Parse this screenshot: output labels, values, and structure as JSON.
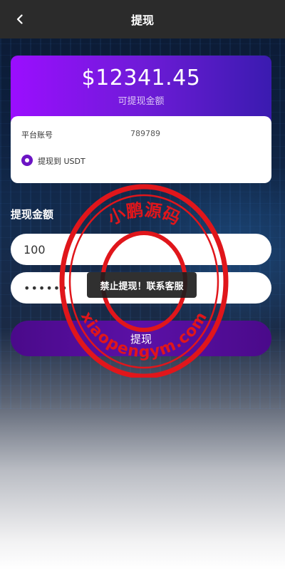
{
  "header": {
    "title": "提现",
    "back_icon": "chevron-left-icon"
  },
  "balance": {
    "amount": "$12341.45",
    "label": "可提现金额"
  },
  "account": {
    "label": "平台账号",
    "value": "789789"
  },
  "method": {
    "label": "提现到 USDT",
    "selected": true
  },
  "form": {
    "section_label": "提现金额",
    "amount_value": "100",
    "password_value": "••••••",
    "submit_label": "提现"
  },
  "toast": {
    "message": "禁止提现！联系客服"
  },
  "watermark": {
    "top_text": "小鹏源码",
    "bottom_text": "xiaopengym.com"
  },
  "colors": {
    "accent_purple": "#6c14c4",
    "card_gradient_start": "#9b0eff",
    "card_gradient_end": "#3a1bb0",
    "stamp_red": "#e0161b",
    "topbar_bg": "#2b2b2b"
  }
}
